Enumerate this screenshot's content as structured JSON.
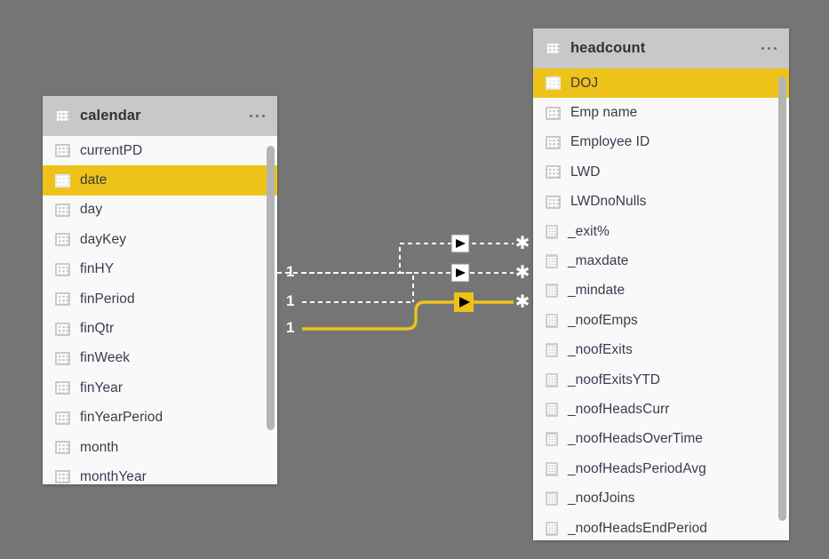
{
  "app": {
    "view_name": "model-view",
    "canvas_background": "#757575",
    "accent_color": "#edc31a",
    "header_background": "#c8c8c8",
    "card_background": "#f9f9f9"
  },
  "tables": [
    {
      "id": "calendar",
      "title": "calendar",
      "menu_label": "...",
      "table_icon": "table-icon",
      "menu_icon": "more-options-icon",
      "fields": [
        {
          "label": "currentPD",
          "kind": "column",
          "icon": "column-icon",
          "selected": false
        },
        {
          "label": "date",
          "kind": "column",
          "icon": "column-icon",
          "selected": true
        },
        {
          "label": "day",
          "kind": "column",
          "icon": "column-icon",
          "selected": false
        },
        {
          "label": "dayKey",
          "kind": "column",
          "icon": "column-icon",
          "selected": false
        },
        {
          "label": "finHY",
          "kind": "column",
          "icon": "column-icon",
          "selected": false
        },
        {
          "label": "finPeriod",
          "kind": "column",
          "icon": "column-icon",
          "selected": false
        },
        {
          "label": "finQtr",
          "kind": "column",
          "icon": "column-icon",
          "selected": false
        },
        {
          "label": "finWeek",
          "kind": "column",
          "icon": "column-icon",
          "selected": false
        },
        {
          "label": "finYear",
          "kind": "column",
          "icon": "column-icon",
          "selected": false
        },
        {
          "label": "finYearPeriod",
          "kind": "column",
          "icon": "column-icon",
          "selected": false
        },
        {
          "label": "month",
          "kind": "column",
          "icon": "column-icon",
          "selected": false
        },
        {
          "label": "monthYear",
          "kind": "column",
          "icon": "column-icon",
          "selected": false
        }
      ]
    },
    {
      "id": "headcount",
      "title": "headcount",
      "menu_label": "...",
      "table_icon": "table-icon",
      "menu_icon": "more-options-icon",
      "fields": [
        {
          "label": "DOJ",
          "kind": "column",
          "icon": "column-icon",
          "selected": true
        },
        {
          "label": "Emp name",
          "kind": "column",
          "icon": "column-icon",
          "selected": false
        },
        {
          "label": "Employee ID",
          "kind": "column",
          "icon": "column-icon",
          "selected": false
        },
        {
          "label": "LWD",
          "kind": "column",
          "icon": "column-icon",
          "selected": false
        },
        {
          "label": "LWDnoNulls",
          "kind": "column",
          "icon": "column-icon",
          "selected": false
        },
        {
          "label": "_exit%",
          "kind": "measure",
          "icon": "measure-icon",
          "selected": false
        },
        {
          "label": "_maxdate",
          "kind": "measure",
          "icon": "measure-icon",
          "selected": false
        },
        {
          "label": "_mindate",
          "kind": "measure",
          "icon": "measure-icon",
          "selected": false
        },
        {
          "label": "_noofEmps",
          "kind": "measure",
          "icon": "measure-icon",
          "selected": false
        },
        {
          "label": "_noofExits",
          "kind": "measure",
          "icon": "measure-icon",
          "selected": false
        },
        {
          "label": "_noofExitsYTD",
          "kind": "measure",
          "icon": "measure-icon",
          "selected": false
        },
        {
          "label": "_noofHeadsCurr",
          "kind": "measure",
          "icon": "measure-icon",
          "selected": false
        },
        {
          "label": "_noofHeadsOverTime",
          "kind": "measure",
          "icon": "measure-icon",
          "selected": false
        },
        {
          "label": "_noofHeadsPeriodAvg",
          "kind": "measure",
          "icon": "measure-icon",
          "selected": false
        },
        {
          "label": "_noofJoins",
          "kind": "measure",
          "icon": "measure-icon",
          "selected": false
        },
        {
          "label": "_noofHeadsEndPeriod",
          "kind": "measure",
          "icon": "measure-icon",
          "selected": false
        }
      ]
    }
  ],
  "relationships": [
    {
      "id": "rel-1",
      "from_cardinality": "",
      "to_cardinality": "*",
      "active": false,
      "state": "inactive",
      "color": "#ffffff",
      "style": "dashed",
      "arrow_icon": "cross-filter-arrow-icon",
      "endpoint_icon": "many-side-asterisk-icon"
    },
    {
      "id": "rel-2",
      "from_cardinality": "1",
      "to_cardinality": "*",
      "active": false,
      "state": "inactive",
      "color": "#ffffff",
      "style": "dashed",
      "arrow_icon": "cross-filter-arrow-icon",
      "endpoint_icon": "many-side-asterisk-icon"
    },
    {
      "id": "rel-3",
      "from_cardinality": "1",
      "to_cardinality": "*",
      "active": true,
      "state": "selected",
      "color": "#edc31a",
      "style": "solid",
      "arrow_icon": "cross-filter-arrow-icon",
      "endpoint_icon": "many-side-asterisk-icon"
    },
    {
      "id": "rel-4",
      "from_cardinality": "1",
      "to_cardinality": "",
      "active": true,
      "state": "selected",
      "color": "#edc31a",
      "style": "solid",
      "arrow_icon": "cross-filter-arrow-icon",
      "endpoint_icon": "many-side-asterisk-icon"
    }
  ],
  "cardinality_labels": [
    "1",
    "1",
    "1"
  ],
  "many_markers": [
    "*",
    "*",
    "*"
  ]
}
